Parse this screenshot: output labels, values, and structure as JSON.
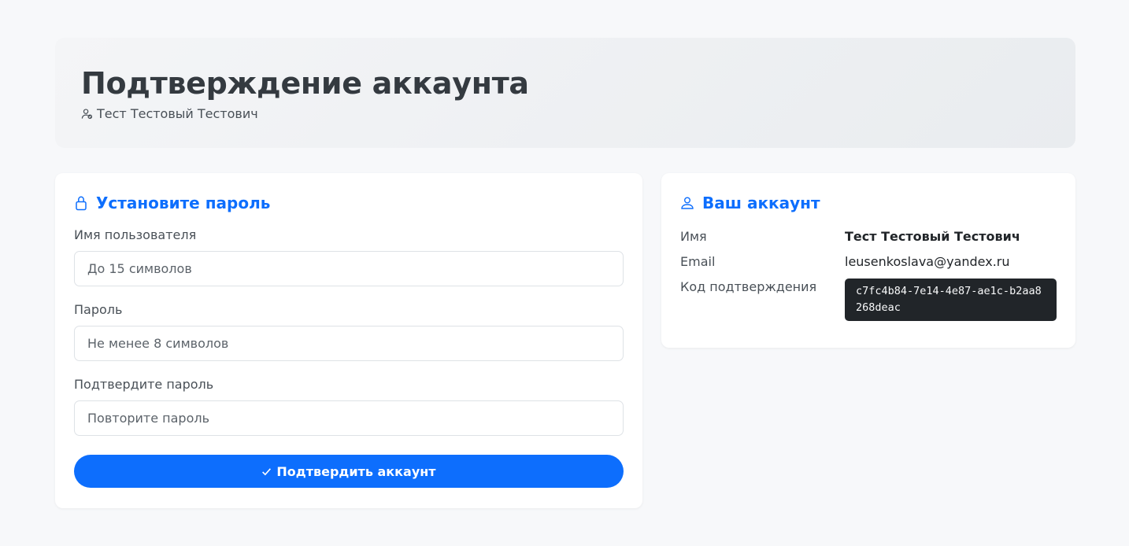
{
  "header": {
    "title": "Подтверждение аккаунта",
    "user_name": "Тест Тестовый Тестович",
    "user_icon": "user-check-icon"
  },
  "password_form": {
    "title": "Установите пароль",
    "title_icon": "lock-icon",
    "username_label": "Имя пользователя",
    "username_placeholder": "До 15 символов",
    "username_value": "",
    "password_label": "Пароль",
    "password_placeholder": "Не менее 8 символов",
    "password_value": "",
    "confirm_label": "Подтвердите пароль",
    "confirm_placeholder": "Повторите пароль",
    "confirm_value": "",
    "submit_label": "Подтвердить аккаунт",
    "submit_icon": "check-icon"
  },
  "account": {
    "title": "Ваш аккаунт",
    "title_icon": "person-icon",
    "name_label": "Имя",
    "name_value": "Тест Тестовый Тестович",
    "email_label": "Email",
    "email_value": "leusenkoslava@yandex.ru",
    "code_label": "Код подтверждения",
    "code_value": "c7fc4b84-7e14-4e87-ae1c-b2aa8268deac"
  },
  "colors": {
    "accent": "#0d6efd",
    "background": "#f7f8fa",
    "code_background": "#212529"
  }
}
